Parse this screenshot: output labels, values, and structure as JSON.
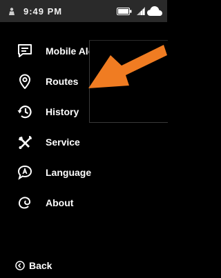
{
  "status_bar": {
    "time": "9:49 PM",
    "icons": [
      "person-icon",
      "battery-icon",
      "signal-icon",
      "cloud-icon"
    ]
  },
  "menu": {
    "items": [
      {
        "label": "Mobile Alerts",
        "icon": "message-alert-icon"
      },
      {
        "label": "Routes",
        "icon": "location-pin-icon"
      },
      {
        "label": "History",
        "icon": "history-clock-icon"
      },
      {
        "label": "Service",
        "icon": "tools-icon"
      },
      {
        "label": "Language",
        "icon": "language-bubble-icon"
      },
      {
        "label": "About",
        "icon": "about-logo-icon"
      }
    ]
  },
  "footer": {
    "back_label": "Back",
    "back_icon": "back-arrow-icon"
  },
  "annotation": {
    "arrow_color": "#f07c22"
  },
  "colors": {
    "background": "#000000",
    "status_bar": "#2a2a2a",
    "text": "#ffffff",
    "accent_arrow": "#f07c22"
  }
}
